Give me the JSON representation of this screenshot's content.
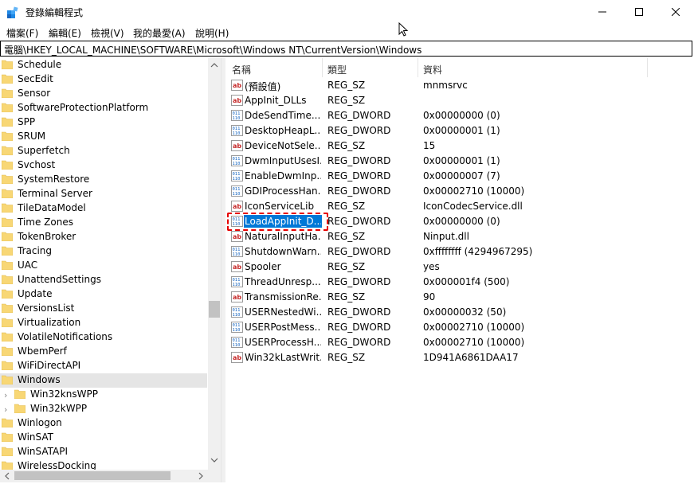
{
  "window": {
    "title": "登錄編輯程式",
    "accent": "#0078d7"
  },
  "menu": [
    "檔案(F)",
    "編輯(E)",
    "檢視(V)",
    "我的最愛(A)",
    "說明(H)"
  ],
  "address": "電腦\\HKEY_LOCAL_MACHINE\\SOFTWARE\\Microsoft\\Windows NT\\CurrentVersion\\Windows",
  "tree": [
    {
      "label": "Schedule"
    },
    {
      "label": "SecEdit"
    },
    {
      "label": "Sensor"
    },
    {
      "label": "SoftwareProtectionPlatform"
    },
    {
      "label": "SPP"
    },
    {
      "label": "SRUM"
    },
    {
      "label": "Superfetch"
    },
    {
      "label": "Svchost"
    },
    {
      "label": "SystemRestore"
    },
    {
      "label": "Terminal Server"
    },
    {
      "label": "TileDataModel"
    },
    {
      "label": "Time Zones"
    },
    {
      "label": "TokenBroker"
    },
    {
      "label": "Tracing"
    },
    {
      "label": "UAC"
    },
    {
      "label": "UnattendSettings"
    },
    {
      "label": "Update"
    },
    {
      "label": "VersionsList"
    },
    {
      "label": "Virtualization"
    },
    {
      "label": "VolatileNotifications"
    },
    {
      "label": "WbemPerf"
    },
    {
      "label": "WiFiDirectAPI"
    },
    {
      "label": "Windows",
      "selected": true
    },
    {
      "label": "Win32knsWPP",
      "child": true
    },
    {
      "label": "Win32kWPP",
      "child": true
    },
    {
      "label": "Winlogon"
    },
    {
      "label": "WinSAT"
    },
    {
      "label": "WinSATAPI"
    },
    {
      "label": "WirelessDocking"
    }
  ],
  "columns": {
    "name": "名稱",
    "type": "類型",
    "data": "資料"
  },
  "values": [
    {
      "icon": "string-value-icon",
      "name": "(預設值)",
      "type": "REG_SZ",
      "data": "mnmsrvc"
    },
    {
      "icon": "string-value-icon",
      "name": "AppInit_DLLs",
      "type": "REG_SZ",
      "data": ""
    },
    {
      "icon": "binary-value-icon",
      "name": "DdeSendTime...",
      "type": "REG_DWORD",
      "data": "0x00000000 (0)"
    },
    {
      "icon": "binary-value-icon",
      "name": "DesktopHeapL...",
      "type": "REG_DWORD",
      "data": "0x00000001 (1)"
    },
    {
      "icon": "string-value-icon",
      "name": "DeviceNotSele...",
      "type": "REG_SZ",
      "data": "15"
    },
    {
      "icon": "binary-value-icon",
      "name": "DwmInputUsesI...",
      "type": "REG_DWORD",
      "data": "0x00000001 (1)"
    },
    {
      "icon": "binary-value-icon",
      "name": "EnableDwmInp...",
      "type": "REG_DWORD",
      "data": "0x00000007 (7)"
    },
    {
      "icon": "binary-value-icon",
      "name": "GDIProcessHan...",
      "type": "REG_DWORD",
      "data": "0x00002710 (10000)"
    },
    {
      "icon": "string-value-icon",
      "name": "IconServiceLib",
      "type": "REG_SZ",
      "data": "IconCodecService.dll"
    },
    {
      "icon": "binary-value-icon",
      "name": "LoadAppInit_D...",
      "type": "REG_DWORD",
      "data": "0x00000000 (0)",
      "selected": true
    },
    {
      "icon": "string-value-icon",
      "name": "NaturalInputHa...",
      "type": "REG_SZ",
      "data": "Ninput.dll"
    },
    {
      "icon": "binary-value-icon",
      "name": "ShutdownWarn...",
      "type": "REG_DWORD",
      "data": "0xffffffff (4294967295)"
    },
    {
      "icon": "string-value-icon",
      "name": "Spooler",
      "type": "REG_SZ",
      "data": "yes"
    },
    {
      "icon": "binary-value-icon",
      "name": "ThreadUnresp...",
      "type": "REG_DWORD",
      "data": "0x000001f4 (500)"
    },
    {
      "icon": "string-value-icon",
      "name": "TransmissionRe...",
      "type": "REG_SZ",
      "data": "90"
    },
    {
      "icon": "binary-value-icon",
      "name": "USERNestedWi...",
      "type": "REG_DWORD",
      "data": "0x00000032 (50)"
    },
    {
      "icon": "binary-value-icon",
      "name": "USERPostMess...",
      "type": "REG_DWORD",
      "data": "0x00002710 (10000)"
    },
    {
      "icon": "binary-value-icon",
      "name": "USERProcessH...",
      "type": "REG_DWORD",
      "data": "0x00002710 (10000)"
    },
    {
      "icon": "string-value-icon",
      "name": "Win32kLastWrit...",
      "type": "REG_SZ",
      "data": "1D941A6861DAA17"
    }
  ]
}
